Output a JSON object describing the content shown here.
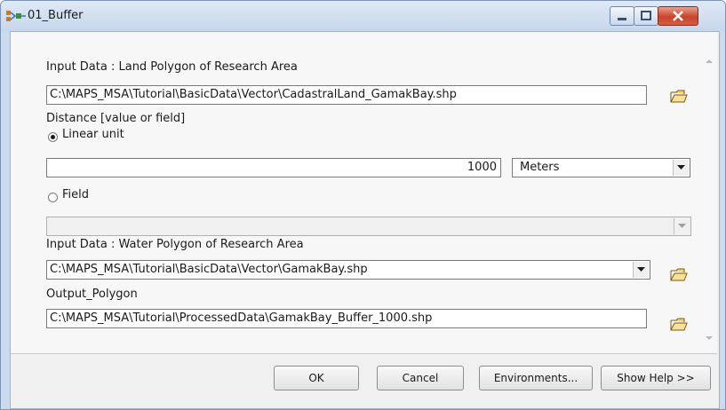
{
  "window": {
    "title": "01_Buffer"
  },
  "input_data": {
    "label": "Input Data : Land Polygon of Research Area",
    "value": "C:\\MAPS_MSA\\Tutorial\\BasicData\\Vector\\CadastralLand_GamakBay.shp"
  },
  "distance": {
    "label": "Distance [value or field]",
    "linear_unit_label": "Linear unit",
    "linear_unit_selected": true,
    "value": "1000",
    "unit": "Meters",
    "field_label": "Field",
    "field_selected": false,
    "field_value": ""
  },
  "water_data": {
    "label": "Input Data : Water Polygon of Research Area",
    "value": "C:\\MAPS_MSA\\Tutorial\\BasicData\\Vector\\GamakBay.shp"
  },
  "output": {
    "label": "Output_Polygon",
    "value": "C:\\MAPS_MSA\\Tutorial\\ProcessedData\\GamakBay_Buffer_1000.shp"
  },
  "buttons": {
    "ok": "OK",
    "cancel": "Cancel",
    "environments": "Environments...",
    "show_help": "Show Help >>"
  },
  "icons": {
    "app": "model-tool-icon",
    "browse": "open-folder-icon",
    "minimize": "minimize-icon",
    "maximize": "maximize-icon",
    "close": "close-icon"
  }
}
